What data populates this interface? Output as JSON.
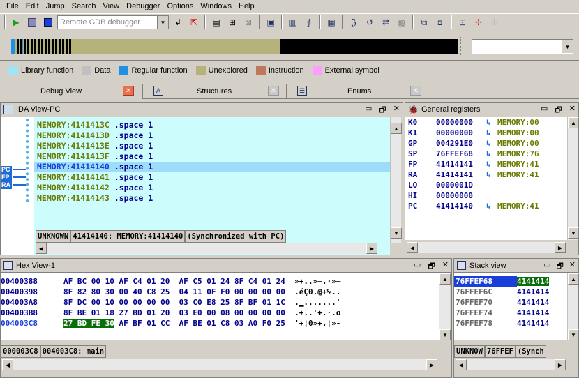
{
  "menu": [
    "File",
    "Edit",
    "Jump",
    "Search",
    "View",
    "Debugger",
    "Options",
    "Windows",
    "Help"
  ],
  "toolbar": {
    "debugger_select": "Remote GDB debugger"
  },
  "legend": [
    {
      "label": "Library function",
      "color": "#9ee6f3"
    },
    {
      "label": "Data",
      "color": "#c0c0c0"
    },
    {
      "label": "Regular function",
      "color": "#1e90e6"
    },
    {
      "label": "Unexplored",
      "color": "#b5b37a"
    },
    {
      "label": "Instruction",
      "color": "#c0785a"
    },
    {
      "label": "External symbol",
      "color": "#ff9cff"
    }
  ],
  "tabs": {
    "debug": "Debug View",
    "structures": "Structures",
    "enums": "Enums"
  },
  "ida_view": {
    "title": "IDA View-PC",
    "lines": [
      {
        "addr": "MEMORY:4141413C",
        "op": ".space 1"
      },
      {
        "addr": "MEMORY:4141413D",
        "op": ".space 1"
      },
      {
        "addr": "MEMORY:4141413E",
        "op": ".space 1"
      },
      {
        "addr": "MEMORY:4141413F",
        "op": ".space 1"
      },
      {
        "addr": "MEMORY:41414140",
        "op": ".space 1"
      },
      {
        "addr": "MEMORY:41414141",
        "op": ".space 1"
      },
      {
        "addr": "MEMORY:41414142",
        "op": ".space 1"
      },
      {
        "addr": "MEMORY:41414143",
        "op": ".space 1"
      }
    ],
    "markers": [
      "PC",
      "FP",
      "RA"
    ],
    "status": [
      "UNKNOWN",
      "41414140: MEMORY:41414140",
      "(Synchronized with PC)"
    ]
  },
  "registers": {
    "title": "General registers",
    "rows": [
      {
        "name": "K0",
        "value": "00000000",
        "ref": "MEMORY:00"
      },
      {
        "name": "K1",
        "value": "00000000",
        "ref": "MEMORY:00"
      },
      {
        "name": "GP",
        "value": "004291E0",
        "ref": "MEMORY:00"
      },
      {
        "name": "SP",
        "value": "76FFEF68",
        "ref": "MEMORY:76"
      },
      {
        "name": "FP",
        "value": "41414141",
        "ref": "MEMORY:41"
      },
      {
        "name": "RA",
        "value": "41414141",
        "ref": "MEMORY:41"
      },
      {
        "name": "LO",
        "value": "0000001D",
        "ref": ""
      },
      {
        "name": "HI",
        "value": "00000000",
        "ref": ""
      },
      {
        "name": "PC",
        "value": "41414140",
        "ref": "MEMORY:41"
      }
    ]
  },
  "hex_view": {
    "title": "Hex View-1",
    "rows": [
      {
        "addr": "00400388",
        "bytes": "AF BC 00 10 AF C4 01 20  AF C5 01 24 8F C4 01 24",
        "ascii": "»+..»–.·»–"
      },
      {
        "addr": "00400398",
        "bytes": "8F 82 80 30 00 40 C8 25  04 11 0F F0 00 00 00 00",
        "ascii": ".éÇ0.@+%.."
      },
      {
        "addr": "004003A8",
        "bytes": "8F DC 00 10 00 00 00 00  03 C0 E8 25 8F BF 01 1C",
        "ascii": ".▁.......'"
      },
      {
        "addr": "004003B8",
        "bytes": "8F BE 01 18 27 BD 01 20  03 E0 00 08 00 00 00 00",
        "ascii": ".+..'+.·.ɑ"
      },
      {
        "addr": "004003C8",
        "bytes_hl": "27 BD FE 30",
        "bytes": " AF BF 01 CC  AF BE 01 C8 03 A0 F0 25",
        "ascii": "'+¦0»+.¦»-"
      }
    ],
    "status": [
      "000003C8",
      "004003C8: main"
    ]
  },
  "stack": {
    "title": "Stack view",
    "rows": [
      {
        "addr": "76FFEF68",
        "val": "4141414"
      },
      {
        "addr": "76FFEF6C",
        "val": "4141414"
      },
      {
        "addr": "76FFEF70",
        "val": "4141414"
      },
      {
        "addr": "76FFEF74",
        "val": "4141414"
      },
      {
        "addr": "76FFEF78",
        "val": "4141414"
      }
    ],
    "status": [
      "UNKNOW",
      "76FFEF",
      "(Synch"
    ]
  }
}
